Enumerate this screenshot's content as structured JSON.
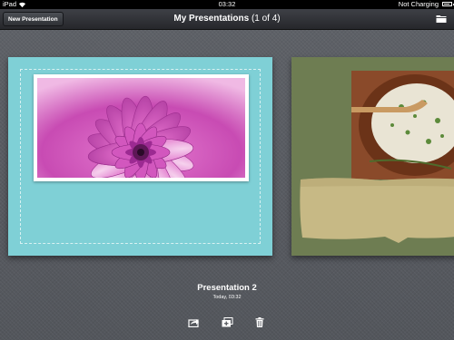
{
  "status_bar": {
    "device": "iPad",
    "time": "03:32",
    "charging_text": "Not Charging",
    "battery_level": 0.9
  },
  "toolbar": {
    "new_button_label": "New Presentation",
    "title": "My Presentations",
    "count": "(1 of 4)",
    "folder_icon": "folder-icon"
  },
  "presentation": {
    "name": "Presentation 2",
    "date": "Today, 03:32"
  },
  "actions": [
    "share-icon",
    "duplicate-icon",
    "trash-icon"
  ],
  "colors": {
    "teal_card": "#7fd0d6",
    "green_card": "#6e7d52",
    "background": "#5a5d63"
  }
}
